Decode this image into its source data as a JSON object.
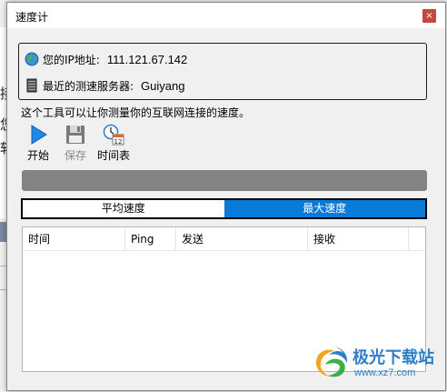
{
  "background_app": {
    "partial_chars": [
      "接",
      "您",
      "软"
    ]
  },
  "window": {
    "title": "速度计",
    "close_glyph": "×"
  },
  "info": {
    "ip_label": "您的IP地址:",
    "ip_value": "111.121.67.142",
    "server_label": "最近的测速服务器:",
    "server_value": "Guiyang"
  },
  "description": "这个工具可以让你测量你的互联网连接的速度。",
  "toolbar": {
    "start_label": "开始",
    "save_label": "保存",
    "schedule_label": "时间表",
    "schedule_icon_number": "12"
  },
  "progress": {
    "value": 0
  },
  "tabs": [
    {
      "label": "平均速度",
      "active": false
    },
    {
      "label": "最大速度",
      "active": true
    }
  ],
  "list": {
    "columns": [
      "时间",
      "Ping",
      "发送",
      "接收",
      ""
    ]
  },
  "watermark": {
    "text": "极光下载站",
    "url": "www.xz7.com"
  },
  "colors": {
    "active_tab": "#0a7ad8",
    "progress_track": "#838383",
    "close_button": "#c84840",
    "watermark": "#2f7fc8"
  }
}
